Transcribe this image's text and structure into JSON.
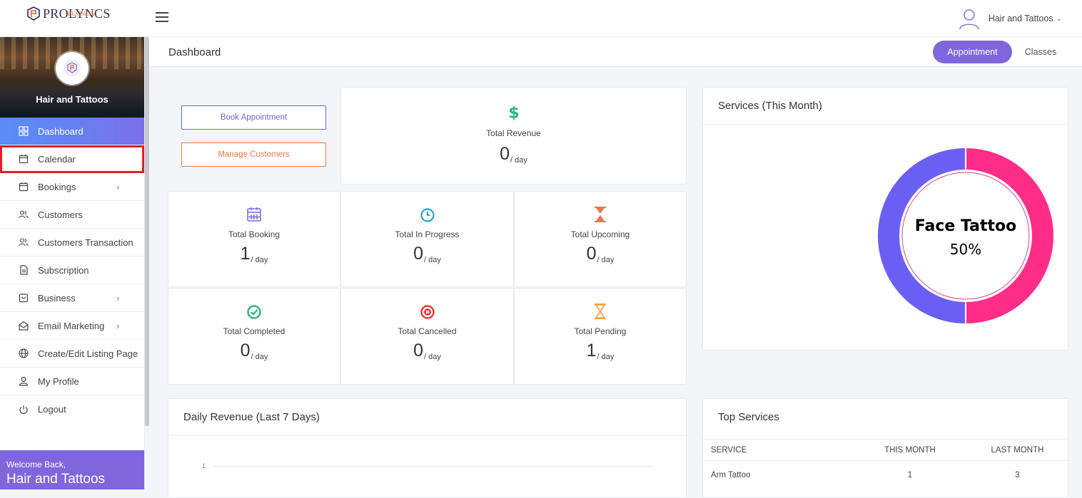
{
  "brand": {
    "name": "PROLYNCS",
    "sub": "BUSINESS"
  },
  "user": {
    "name": "Hair and Tattoos"
  },
  "sidebar": {
    "profile_name": "Hair and Tattoos",
    "items": [
      {
        "label": "Dashboard",
        "icon": "grid-icon",
        "active": true
      },
      {
        "label": "Calendar",
        "icon": "calendar-icon",
        "highlighted": true
      },
      {
        "label": "Bookings",
        "icon": "calendar-icon",
        "has_submenu": true
      },
      {
        "label": "Customers",
        "icon": "users-icon"
      },
      {
        "label": "Customers Transaction",
        "icon": "users-icon"
      },
      {
        "label": "Subscription",
        "icon": "document-icon"
      },
      {
        "label": "Business",
        "icon": "briefcase-icon",
        "has_submenu": true
      },
      {
        "label": "Email Marketing",
        "icon": "envelope-icon",
        "has_submenu": true
      },
      {
        "label": "Create/Edit Listing Page",
        "icon": "globe-icon"
      },
      {
        "label": "My Profile",
        "icon": "user-icon"
      },
      {
        "label": "Logout",
        "icon": "power-icon"
      }
    ],
    "welcome_small": "Welcome Back,",
    "welcome_name": "Hair and Tattoos"
  },
  "header": {
    "title": "Dashboard",
    "tabs": [
      {
        "label": "Appointment",
        "active": true
      },
      {
        "label": "Classes",
        "active": false
      }
    ]
  },
  "actions": {
    "book": "Book Appointment",
    "manage": "Manage Customers"
  },
  "revenue": {
    "label": "Total Revenue",
    "value": "0",
    "unit": "/ day",
    "icon": "dollar-icon",
    "color": "#2eb67d"
  },
  "stats": [
    {
      "label": "Total Booking",
      "value": "1",
      "unit": "/ day",
      "icon": "calendar-icon",
      "color": "#7f66dd"
    },
    {
      "label": "Total In Progress",
      "value": "0",
      "unit": "/ day",
      "icon": "clock-icon",
      "color": "#2a9fd8"
    },
    {
      "label": "Total Upcoming",
      "value": "0",
      "unit": "/ day",
      "icon": "hourglass-icon",
      "color": "#e8784f"
    },
    {
      "label": "Total Completed",
      "value": "0",
      "unit": "/ day",
      "icon": "check-circle-icon",
      "color": "#2eb67d"
    },
    {
      "label": "Total Cancelled",
      "value": "0",
      "unit": "/ day",
      "icon": "x-circle-icon",
      "color": "#e53935"
    },
    {
      "label": "Total Pending",
      "value": "1",
      "unit": "/ day",
      "icon": "hourglass-outline-icon",
      "color": "#f5a13a"
    }
  ],
  "services_card": {
    "title": "Services (This Month)"
  },
  "chart_data": [
    {
      "type": "pie",
      "title": "Services (This Month)",
      "slices": [
        {
          "name": "Face Tattoo",
          "value": 50,
          "color": "#ff2d87"
        },
        {
          "name": "",
          "value": 50,
          "color": "#6a5ff5"
        }
      ],
      "center_label": "Face Tattoo",
      "center_value": "50%"
    },
    {
      "type": "line",
      "title": "Daily Revenue (Last 7 Days)",
      "y_ticks": [
        "1"
      ]
    }
  ],
  "revenue_chart": {
    "title": "Daily Revenue (Last 7 Days)",
    "y_tick": "1"
  },
  "top_services": {
    "title": "Top Services",
    "columns": [
      "SERVICE",
      "THIS MONTH",
      "LAST MONTH"
    ],
    "rows": [
      {
        "service": "Arm Tattoo",
        "this_month": "1",
        "last_month": "3"
      }
    ]
  }
}
